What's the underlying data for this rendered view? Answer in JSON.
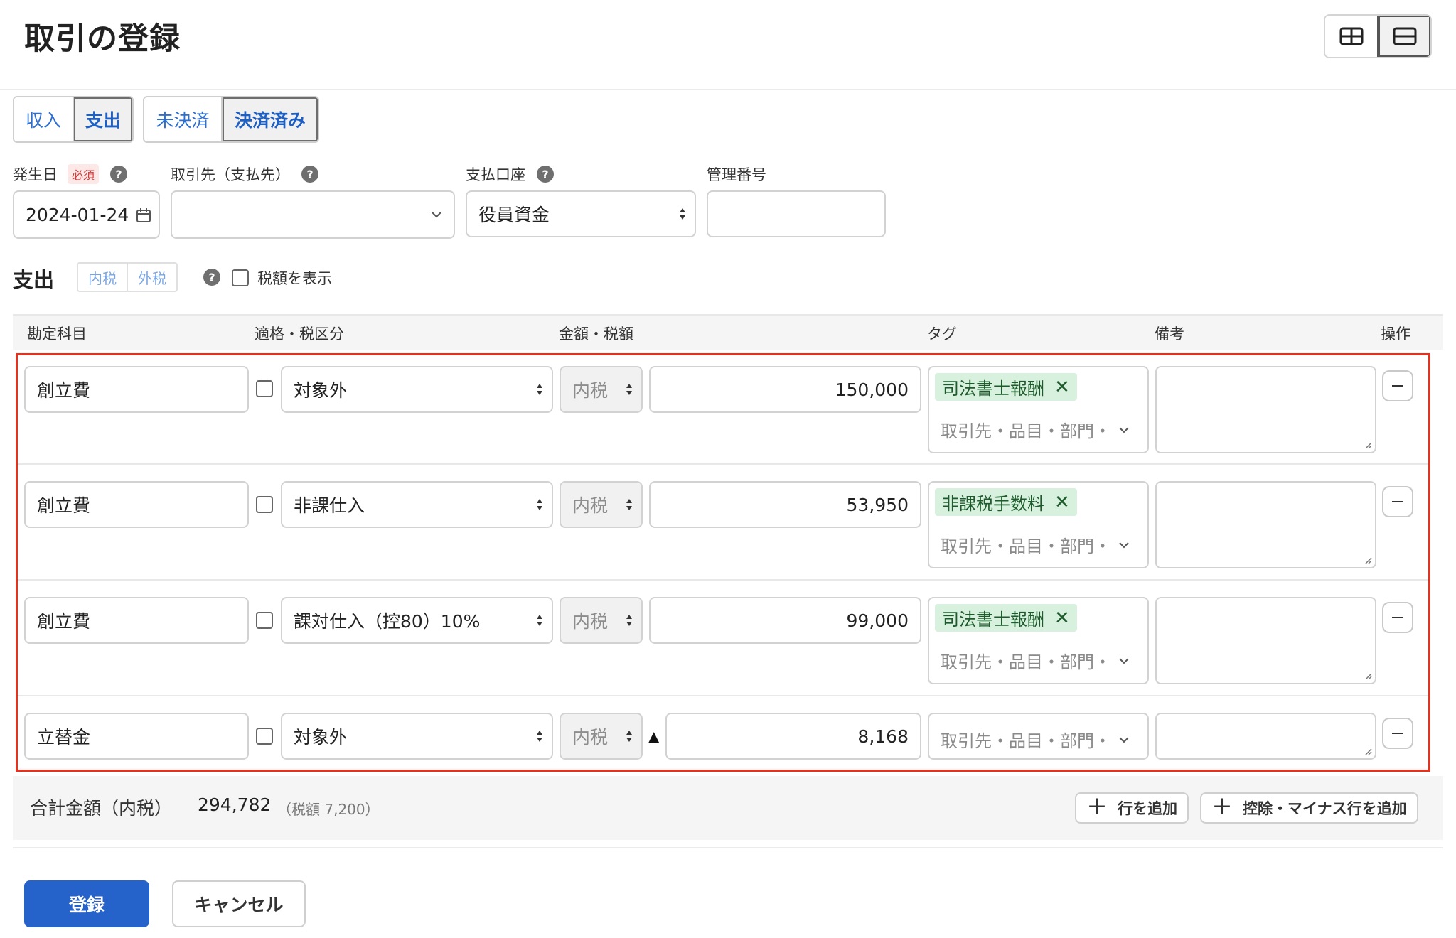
{
  "header": {
    "title": "取引の登録"
  },
  "type_toggle": {
    "income": "収入",
    "expense": "支出",
    "selected": "支出"
  },
  "settle_toggle": {
    "unsettled": "未決済",
    "settled": "決済済み",
    "selected": "決済済み"
  },
  "fields": {
    "date": {
      "label": "発生日",
      "required_badge": "必須",
      "value": "2024-01-24"
    },
    "partner": {
      "label": "取引先（支払先）",
      "value": ""
    },
    "account": {
      "label": "支払口座",
      "value": "役員資金"
    },
    "ref": {
      "label": "管理番号",
      "value": ""
    }
  },
  "section": {
    "title": "支出",
    "tax_modes": [
      "内税",
      "外税"
    ],
    "show_tax_label": "税額を表示"
  },
  "table": {
    "headers": [
      "勘定科目",
      "適格・税区分",
      "金額・税額",
      "タグ",
      "備考",
      "操作"
    ],
    "rows": [
      {
        "account": "創立費",
        "tax_category": "対象外",
        "tax_mode": "内税",
        "amount": "150,000",
        "tag": "司法書士報酬",
        "tag_placeholder": "取引先・品目・部門・",
        "deduction": false
      },
      {
        "account": "創立費",
        "tax_category": "非課仕入",
        "tax_mode": "内税",
        "amount": "53,950",
        "tag": "非課税手数料",
        "tag_placeholder": "取引先・品目・部門・",
        "deduction": false
      },
      {
        "account": "創立費",
        "tax_category": "課対仕入（控80）10%",
        "tax_mode": "内税",
        "amount": "99,000",
        "tag": "司法書士報酬",
        "tag_placeholder": "取引先・品目・部門・",
        "deduction": false
      },
      {
        "account": "立替金",
        "tax_category": "対象外",
        "tax_mode": "内税",
        "amount": "8,168",
        "tag": "",
        "tag_placeholder": "取引先・品目・部門・",
        "deduction": true,
        "deduction_mark": "▲"
      }
    ]
  },
  "totals": {
    "label": "合計金額（内税）",
    "value": "294,782",
    "tax": "（税額 7,200）",
    "add_row": "行を追加",
    "add_minus_row": "控除・マイナス行を追加"
  },
  "actions": {
    "submit": "登録",
    "cancel": "キャンセル"
  },
  "colors": {
    "primary": "#2562c9",
    "highlight_border": "#e5321f",
    "tag_bg": "#d8f0de"
  }
}
